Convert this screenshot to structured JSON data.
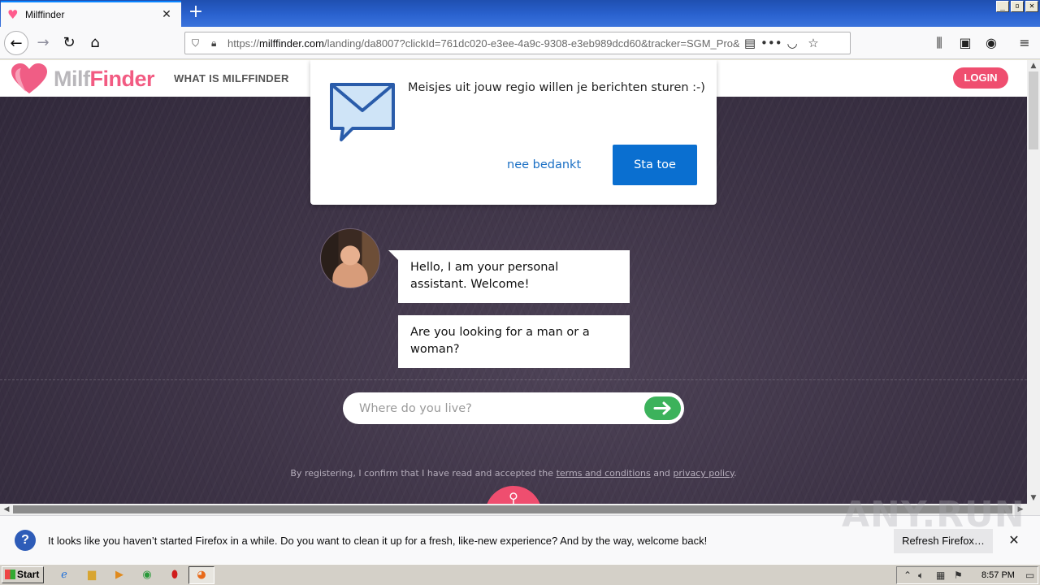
{
  "browser": {
    "tab_title": "Milffinder",
    "url_prefix": "https://",
    "url_domain": "milffinder.com",
    "url_rest": "/landing/da8007?clickId=761dc020-e3ee-4a9c-9308-e3eb989dcd60&tracker=SGM_Pro&p"
  },
  "site": {
    "logo_milf": "Milf",
    "logo_finder": "Finder",
    "nav_what_is": "WHAT IS MILFFINDER",
    "login_label": "LOGIN",
    "brand_color": "#ef4e6f"
  },
  "notification_popup": {
    "message": "Meisjes uit jouw regio willen je berichten sturen :-)",
    "deny_label": "nee bedankt",
    "allow_label": "Sta toe"
  },
  "chat": {
    "bubble1": "Hello, I am your personal assistant. Welcome!",
    "bubble2": "Are you looking for a man or a woman?",
    "location_placeholder": "Where do you live?"
  },
  "footer": {
    "terms_prefix": "By registering, I confirm that I have read and accepted the",
    "terms_link": "terms and conditions",
    "and_word": "and",
    "privacy_link": "privacy policy",
    "period": "."
  },
  "firefox_notification": {
    "text": "It looks like you haven’t started Firefox in a while. Do you want to clean it up for a fresh, like-new experience? And by the way, welcome back!",
    "refresh_label": "Refresh Firefox…"
  },
  "watermark": "ANY.RUN",
  "taskbar": {
    "start_label": "Start",
    "clock": "8:57 PM"
  }
}
